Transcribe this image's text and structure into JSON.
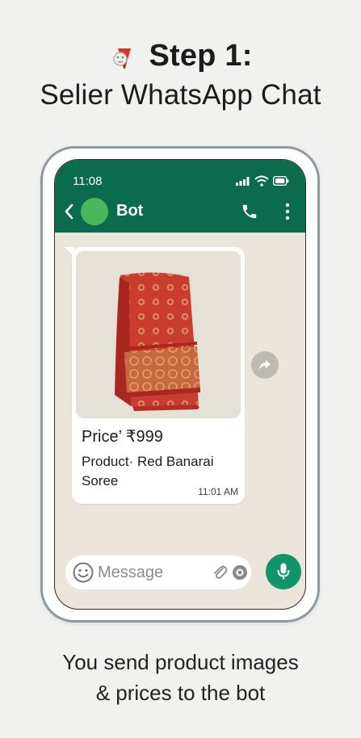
{
  "headline": {
    "step": "Step 1:",
    "subtitle": "Selier WhatsApp Chat"
  },
  "status_bar": {
    "time": "11:08"
  },
  "chat_header": {
    "contact_name": "Bot"
  },
  "message": {
    "price": "Price’ ₹999",
    "product": "Product· Red Banarai Soree",
    "time": "11:01 AM"
  },
  "composer": {
    "placeholder": "Message"
  },
  "caption": {
    "line1": "You send product images",
    "line2": "& prices to the bot"
  },
  "icons": {
    "headline": "pushpin-icon",
    "back": "chevron-left-icon",
    "call": "phone-icon",
    "menu": "more-vertical-icon",
    "forward": "forward-icon",
    "emoji": "emoji-icon",
    "attach": "paperclip-icon",
    "camera": "camera-icon",
    "mic": "microphone-icon"
  },
  "colors": {
    "header": "#0b6b4d",
    "avatar": "#48b85a",
    "mic_button": "#11936b",
    "chat_background": "#ece5db"
  }
}
